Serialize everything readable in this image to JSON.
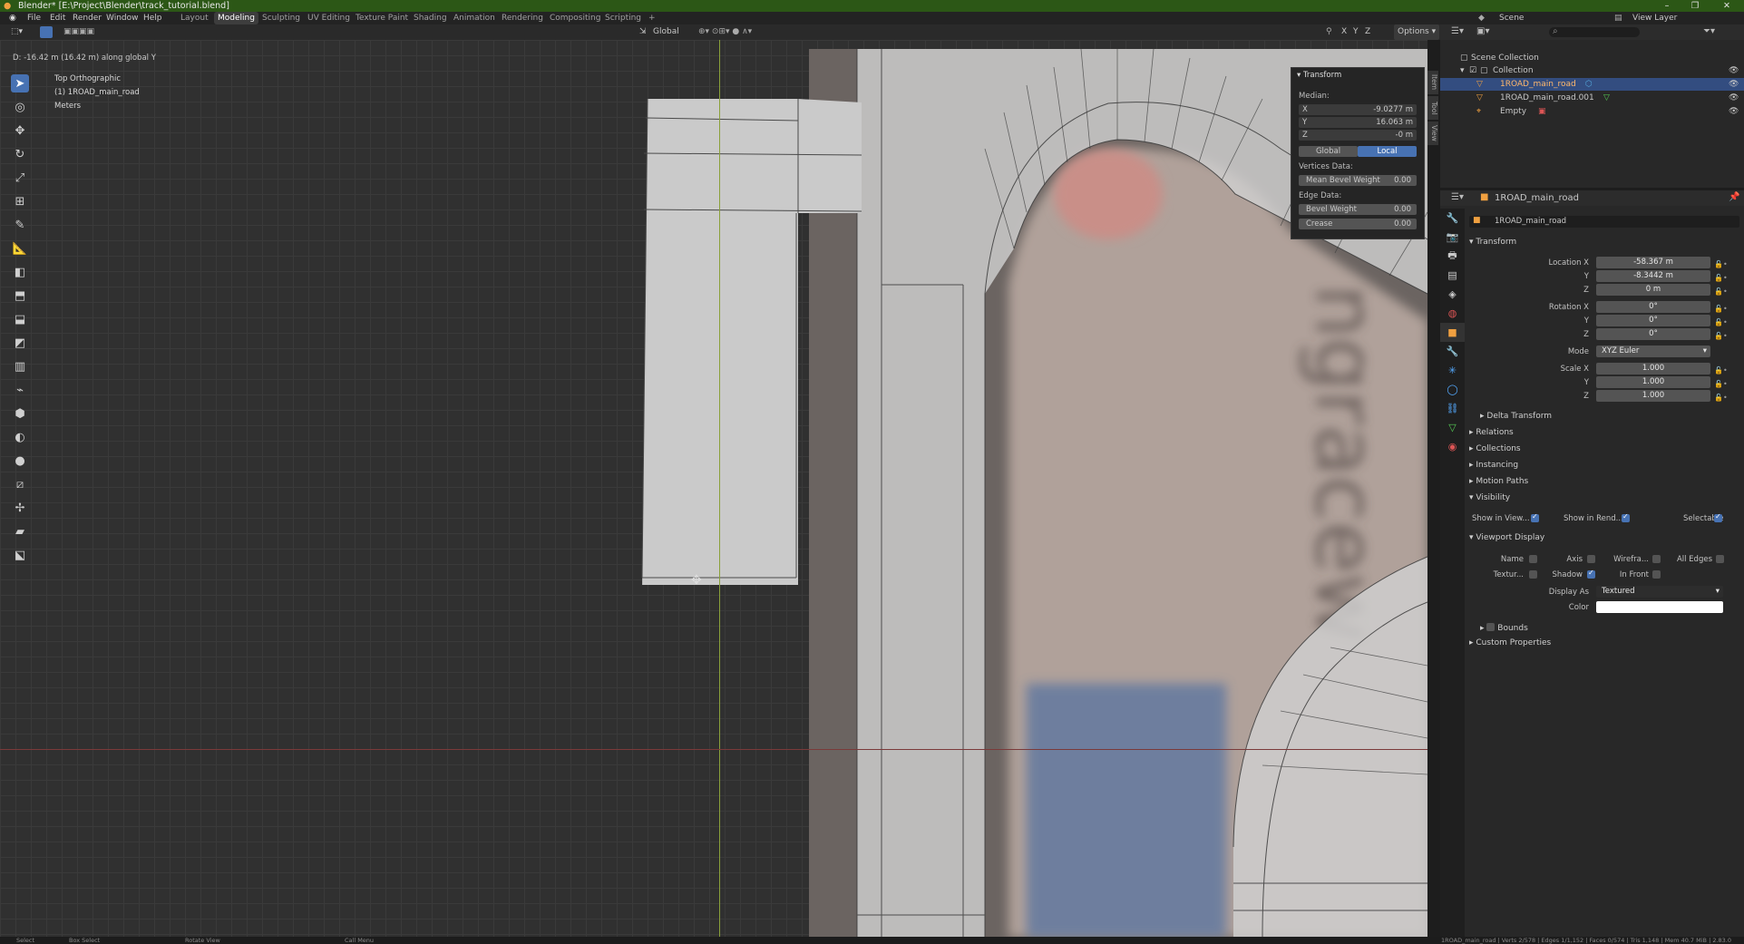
{
  "window": {
    "title": "Blender* [E:\\Project\\Blender\\track_tutorial.blend]",
    "min": "–",
    "max": "❐",
    "close": "✕"
  },
  "menu": {
    "items": [
      "File",
      "Edit",
      "Render",
      "Window",
      "Help"
    ],
    "workspaces": [
      "Layout",
      "Modeling",
      "Sculpting",
      "UV Editing",
      "Texture Paint",
      "Shading",
      "Animation",
      "Rendering",
      "Compositing",
      "Scripting",
      "+"
    ],
    "active_workspace": "Modeling",
    "scene": "Scene",
    "view_layer": "View Layer"
  },
  "viewport": {
    "status_message": "D: -16.42 m (16.42 m) along global Y",
    "view_name": "Top Orthographic",
    "object_label": "(1) 1ROAD_main_road",
    "units": "Meters",
    "orientation": "Global",
    "options": "Options",
    "axes": [
      "X",
      "Y",
      "Z"
    ]
  },
  "npanel": {
    "header": "Transform",
    "median_label": "Median:",
    "x": {
      "label": "X",
      "value": "-9.0277 m"
    },
    "y": {
      "label": "Y",
      "value": "16.063 m"
    },
    "z": {
      "label": "Z",
      "value": "-0 m"
    },
    "global_btn": "Global",
    "local_btn": "Local",
    "vertices_label": "Vertices Data:",
    "mean_bevel": {
      "label": "Mean Bevel Weight",
      "value": "0.00"
    },
    "edge_label": "Edge Data:",
    "bevel_weight": {
      "label": "Bevel Weight",
      "value": "0.00"
    },
    "crease": {
      "label": "Crease",
      "value": "0.00"
    },
    "tabs": [
      "Item",
      "Tool",
      "View"
    ]
  },
  "outliner": {
    "scene_collection": "Scene Collection",
    "collection": "Collection",
    "objects": [
      "1ROAD_main_road",
      "1ROAD_main_road.001",
      "Empty"
    ]
  },
  "properties": {
    "object_name": "1ROAD_main_road",
    "object_field": "1ROAD_main_road",
    "transform_header": "Transform",
    "location": {
      "label": "Location X",
      "x": "-58.367 m",
      "y": "-8.3442 m",
      "z": "0 m"
    },
    "rotation": {
      "label": "Rotation X",
      "x": "0°",
      "y": "0°",
      "z": "0°"
    },
    "mode": {
      "label": "Mode",
      "value": "XYZ Euler"
    },
    "scale": {
      "label": "Scale X",
      "x": "1.000",
      "y": "1.000",
      "z": "1.000"
    },
    "y_label": "Y",
    "z_label": "Z",
    "sections": [
      "Delta Transform",
      "Relations",
      "Collections",
      "Instancing",
      "Motion Paths",
      "Visibility"
    ],
    "visibility": {
      "show_in_view": "Show in View...",
      "show_in_render": "Show in Rend...",
      "selectable": "Selectable"
    },
    "viewport_display": "Viewport Display",
    "vd": {
      "name": "Name",
      "axis": "Axis",
      "wireframe": "Wirefra...",
      "all_edges": "All Edges",
      "texture": "Textur...",
      "shadow": "Shadow",
      "in_front": "In Front"
    },
    "display_as": {
      "label": "Display As",
      "value": "Textured"
    },
    "color": {
      "label": "Color",
      "value": "#ffffff"
    },
    "bounds": "Bounds",
    "custom_props": "Custom Properties"
  },
  "statusbar": {
    "left": [
      "Select",
      "Box Select",
      "Rotate View",
      "Call Menu"
    ],
    "right": "1ROAD_main_road | Verts 2/578 | Edges 1/1,152 | Faces 0/574 | Tris 1,148 | Mem 40.7 MiB | 2.83.0"
  },
  "colors": {
    "accent": "#4772b3",
    "titlebar": "#2c5716",
    "mesh": "#c4c4c4",
    "y_axis": "#8aa03a",
    "x_axis": "#8a3a3a"
  }
}
